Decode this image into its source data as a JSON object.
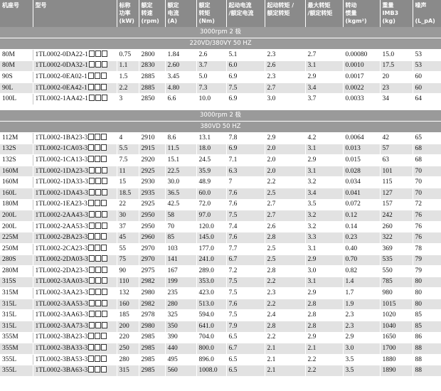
{
  "headers": [
    "机座号",
    "型号",
    "标称\n功率\n(kW)",
    "额定\n转速\n(rpm)",
    "额定\n电流\n(A)",
    "额定\n转矩\n(Nm)",
    "起动电流\n/额定电流",
    "起动转矩 /\n额定转矩",
    "最大转矩\n/额定转矩",
    "转动\n惯量\n(kgm²)",
    "重量\nIMB3\n(kg)",
    "噪声\n\n(L_pA)"
  ],
  "sections": [
    {
      "title_lines": [
        "3000rpm 2 极",
        "220VD/380VY  50 HZ"
      ],
      "rows": [
        [
          "80M",
          "1TL0002-0DA22-1",
          "0.75",
          "2800",
          "1.84",
          "2.6",
          "5.1",
          "2.3",
          "2.7",
          "0.00080",
          "15.0",
          "53"
        ],
        [
          "80M",
          "1TL0002-0DA32-1",
          "1.1",
          "2830",
          "2.60",
          "3.7",
          "6.0",
          "2.6",
          "3.1",
          "0.0010",
          "17.5",
          "53"
        ],
        [
          "90S",
          "1TL0002-0EA02-1",
          "1.5",
          "2885",
          "3.45",
          "5.0",
          "6.9",
          "2.3",
          "2.9",
          "0.0017",
          "20",
          "60"
        ],
        [
          "90L",
          "1TL0002-0EA42-1",
          "2.2",
          "2885",
          "4.80",
          "7.3",
          "7.5",
          "2.7",
          "3.4",
          "0.0022",
          "23",
          "60"
        ],
        [
          "100L",
          "1TL0002-1AA42-1",
          "3",
          "2850",
          "6.6",
          "10.0",
          "6.9",
          "3.0",
          "3.7",
          "0.0033",
          "34",
          "64"
        ]
      ]
    },
    {
      "title_lines": [
        "3000rpm 2 极",
        "380VD  50 HZ"
      ],
      "rows": [
        [
          "112M",
          "1TL0002-1BA23-3",
          "4",
          "2910",
          "8.6",
          "13.1",
          "7.8",
          "2.9",
          "4.2",
          "0.0064",
          "42",
          "65"
        ],
        [
          "132S",
          "1TL0002-1CA03-3",
          "5.5",
          "2915",
          "11.5",
          "18.0",
          "6.9",
          "2.0",
          "3.1",
          "0.013",
          "57",
          "68"
        ],
        [
          "132S",
          "1TL0002-1CA13-3",
          "7.5",
          "2920",
          "15.1",
          "24.5",
          "7.1",
          "2.0",
          "2.9",
          "0.015",
          "63",
          "68"
        ],
        [
          "160M",
          "1TL0002-1DA23-3",
          "11",
          "2925",
          "22.5",
          "35.9",
          "6.3",
          "2.0",
          "3.1",
          "0.028",
          "101",
          "70"
        ],
        [
          "160M",
          "1TL0002-1DA33-3",
          "15",
          "2930",
          "30.0",
          "48.9",
          "7",
          "2.2",
          "3.2",
          "0.034",
          "115",
          "70"
        ],
        [
          "160L",
          "1TL0002-1DA43-3",
          "18.5",
          "2935",
          "36.5",
          "60.0",
          "7.6",
          "2.5",
          "3.4",
          "0.041",
          "127",
          "70"
        ],
        [
          "180M",
          "1TL0002-1EA23-3",
          "22",
          "2925",
          "42.5",
          "72.0",
          "7.6",
          "2.7",
          "3.5",
          "0.072",
          "157",
          "72"
        ],
        [
          "200L",
          "1TL0002-2AA43-3",
          "30",
          "2950",
          "58",
          "97.0",
          "7.5",
          "2.7",
          "3.2",
          "0.12",
          "242",
          "76"
        ],
        [
          "200L",
          "1TL0002-2AA53-3",
          "37",
          "2950",
          "70",
          "120.0",
          "7.4",
          "2.6",
          "3.2",
          "0.14",
          "260",
          "76"
        ],
        [
          "225M",
          "1TL0002-2BA23-3",
          "45",
          "2960",
          "85",
          "145.0",
          "7.6",
          "2.8",
          "3.3",
          "0.23",
          "322",
          "76"
        ],
        [
          "250M",
          "1TL0002-2CA23-3",
          "55",
          "2970",
          "103",
          "177.0",
          "7.7",
          "2.5",
          "3.1",
          "0.40",
          "369",
          "78"
        ],
        [
          "280S",
          "1TL0002-2DA03-3",
          "75",
          "2970",
          "141",
          "241.0",
          "6.7",
          "2.5",
          "2.9",
          "0.70",
          "535",
          "79"
        ],
        [
          "280M",
          "1TL0002-2DA23-3",
          "90",
          "2975",
          "167",
          "289.0",
          "7.2",
          "2.8",
          "3.0",
          "0.82",
          "550",
          "79"
        ],
        [
          "315S",
          "1TL0002-3AA03-3",
          "110",
          "2982",
          "199",
          "353.0",
          "7.5",
          "2.2",
          "3.1",
          "1.4",
          "785",
          "80"
        ],
        [
          "315M",
          "1TL0002-3AA23-3",
          "132",
          "2980",
          "235",
          "423.0",
          "7.5",
          "2.3",
          "2.9",
          "1.7",
          "980",
          "80"
        ],
        [
          "315L",
          "1TL0002-3AA53-3",
          "160",
          "2982",
          "280",
          "513.0",
          "7.6",
          "2.2",
          "2.8",
          "1.9",
          "1015",
          "80"
        ],
        [
          "315L",
          "1TL0002-3AA63-3",
          "185",
          "2978",
          "325",
          "594.0",
          "7.5",
          "2.4",
          "2.8",
          "2.3",
          "1020",
          "85"
        ],
        [
          "315L",
          "1TL0002-3AA73-3",
          "200",
          "2980",
          "350",
          "641.0",
          "7.9",
          "2.8",
          "2.8",
          "2.3",
          "1040",
          "85"
        ],
        [
          "355M",
          "1TL0002-3BA23-3",
          "220",
          "2985",
          "390",
          "704.0",
          "6.5",
          "2.2",
          "2.9",
          "2.9",
          "1650",
          "86"
        ],
        [
          "355M",
          "1TL0002-3BA33-3",
          "250",
          "2985",
          "440",
          "800.0",
          "6.7",
          "2.1",
          "2.1",
          "3.0",
          "1700",
          "88"
        ],
        [
          "355L",
          "1TL0002-3BA53-3",
          "280",
          "2985",
          "495",
          "896.0",
          "6.5",
          "2.1",
          "2.2",
          "3.5",
          "1880",
          "88"
        ],
        [
          "355L",
          "1TL0002-3BA63-3",
          "315",
          "2985",
          "560",
          "1008.0",
          "6.5",
          "2.1",
          "2.2",
          "3.5",
          "1890",
          "88"
        ]
      ]
    }
  ]
}
